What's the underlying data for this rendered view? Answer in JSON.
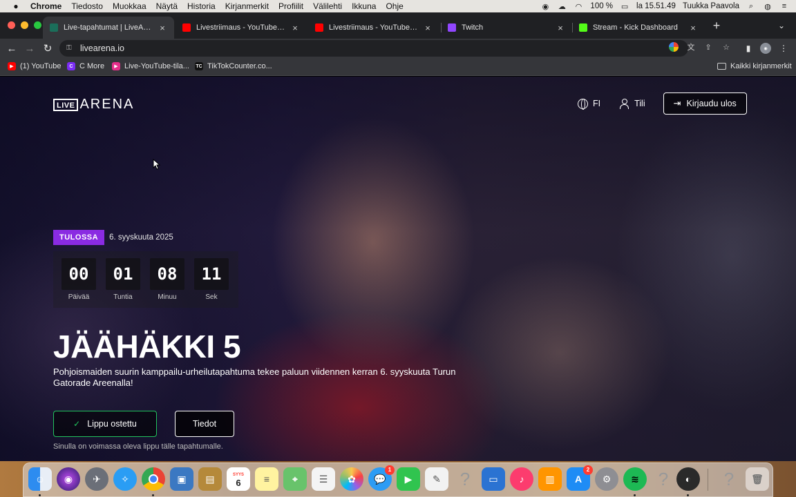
{
  "menubar": {
    "apple": "",
    "app": "Chrome",
    "items": [
      "Tiedosto",
      "Muokkaa",
      "Näytä",
      "Historia",
      "Kirjanmerkit",
      "Profiilit",
      "Välilehti",
      "Ikkuna",
      "Ohje"
    ],
    "battery": "100 %",
    "clock": "la 15.51.49",
    "user": "Tuukka Paavola"
  },
  "tabs": [
    {
      "label": "Live-tapahtumat | LiveArena",
      "color": "#1b6e5a"
    },
    {
      "label": "Livestriimaus - YouTube Studio",
      "color": "#ff0000"
    },
    {
      "label": "Livestriimaus - YouTube Studio",
      "color": "#ff0000"
    },
    {
      "label": "Twitch",
      "color": "#9146ff"
    },
    {
      "label": "Stream - Kick Dashboard",
      "color": "#53fc18"
    }
  ],
  "toolbar": {
    "url": "livearena.io"
  },
  "bookmarks": {
    "items": [
      {
        "label": "(1) YouTube",
        "color": "#ff0000"
      },
      {
        "label": "C More",
        "color": "#7b2cf5"
      },
      {
        "label": "Live-YouTube-tila...",
        "color": "#e62e8a"
      },
      {
        "label": "TikTokCounter.co...",
        "color": "#111111"
      }
    ],
    "all": "Kaikki kirjanmerkit"
  },
  "site": {
    "logo_live": "LIVE",
    "logo_arena": "ARENA",
    "lang": "FI",
    "account": "Tili",
    "logout": "Kirjaudu ulos"
  },
  "event": {
    "status": "TULOSSA",
    "date": "6. syyskuuta 2025",
    "countdown": [
      {
        "value": "00",
        "label": "Päivää"
      },
      {
        "value": "01",
        "label": "Tuntia"
      },
      {
        "value": "08",
        "label": "Minuu"
      },
      {
        "value": "11",
        "label": "Sek"
      }
    ],
    "title": "JÄÄHÄKKI 5",
    "description": "Pohjoismaiden suurin kamppailu-urheilutapahtuma tekee paluun viidennen kerran 6. syyskuuta Turun Gatorade Areenalla!",
    "ticket_button": "Lippu ostettu",
    "details_button": "Tiedot",
    "ticket_note": "Sinulla on voimassa oleva lippu tälle tapahtumalle."
  },
  "dock": {
    "calendar_month": "SYYS",
    "calendar_day": "6",
    "messages_badge": "1",
    "appstore_badge": "2"
  },
  "colors": {
    "accent_purple": "#8a2be2",
    "ticket_green": "#22c55e"
  }
}
